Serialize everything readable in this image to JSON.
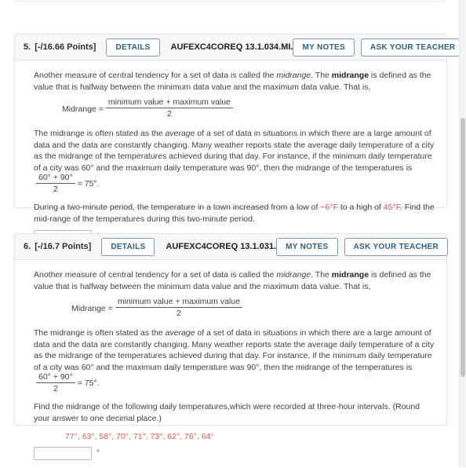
{
  "colors": {
    "accent_blue": "#2c6089",
    "button_border": "#7c9bb5",
    "highlight_red": "#e0584f",
    "header_bg": "#f7f7f7",
    "card_border": "#e1e1e1"
  },
  "buttons": {
    "details": "DETAILS",
    "my_notes": "MY NOTES",
    "ask_your_teacher": "ASK YOUR TEACHER"
  },
  "shared": {
    "intro_part1": "Another measure of central tendency for a set of data is called the ",
    "midrange_italic": "midrange",
    "intro_part2": ". The ",
    "midrange_bold": "midrange",
    "intro_part3": " is defined as the value that is halfway between the minimum data value and the maximum data value. That is,",
    "formula_label": "Midrange =",
    "formula_numerator": "minimum value + maximum value",
    "formula_denominator": "2",
    "paragraph2_part1": "The midrange is often stated as the ",
    "average_italic": "average",
    "paragraph2_part2": " of a set of data in situations in which there are a large amount of data and the data are constantly changing. Many weather reports state the average daily temperature of a city as the midrange of the temperatures achieved during that day. For instance, if the minimum daily temperature of a city was 60° and the maximum daily temperature was 90°, then the midrange of the temperatures is",
    "example_numerator": "60° + 90°",
    "example_denominator": "2",
    "example_result": "= 75°."
  },
  "questions": [
    {
      "number": "5.",
      "points": "[-/16.66 Points]",
      "id": "AUFEXC4COREQ 13.1.034.MI.",
      "prompt_part1": "During a two-minute period, the temperature in a town increased from a low of ",
      "prompt_low": "−6°F",
      "prompt_part2": " to a high of ",
      "prompt_high": "45°F",
      "prompt_part3": ". Find the mid-range of the temperatures during this two-minute period.",
      "answer_value": "",
      "answer_placeholder": "",
      "answer_unit": "°F"
    },
    {
      "number": "6.",
      "points": "[-/16.7 Points]",
      "id": "AUFEXC4COREQ 13.1.031.",
      "prompt": "Find the midrange of the following daily temperatures,which were recorded at three-hour intervals. (Round your answer to one decimal place.)",
      "temperatures": "77°, 63°, 58°, 70°, 71°, 73°, 62°, 76°, 64°",
      "answer_value": "",
      "answer_placeholder": "",
      "answer_unit": "°"
    }
  ]
}
